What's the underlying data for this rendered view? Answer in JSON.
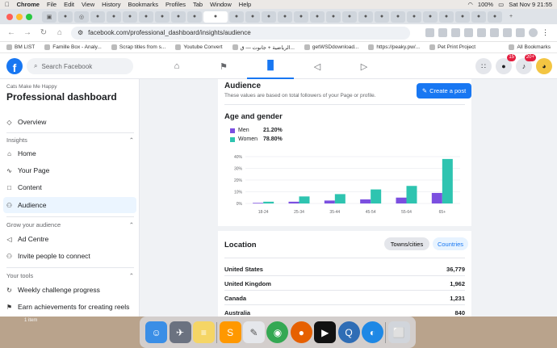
{
  "menubar": {
    "apple": "",
    "app": "Chrome",
    "items": [
      "File",
      "Edit",
      "View",
      "History",
      "Bookmarks",
      "Profiles",
      "Tab",
      "Window",
      "Help"
    ],
    "battery": "100%",
    "datetime": "Sat Nov 9  21:55"
  },
  "browser": {
    "url": "facebook.com/professional_dashboard/insights/audience",
    "bookmarks": [
      "BM LIST",
      "Famille Box - Analy...",
      "Scrap titles from s...",
      "Youtube Convert",
      "الرياضية + جانوت — ق...",
      "getWSDdownload...",
      "https://peaky.pw/...",
      "Pet Print Project"
    ],
    "all_bookmarks": "All Bookmarks"
  },
  "fb": {
    "logo": "f",
    "search_placeholder": "Search Facebook",
    "messenger_badge": "15",
    "notif_badge": "20+"
  },
  "sidebar": {
    "page_name": "Cats Make Me Happy",
    "title": "Professional dashboard",
    "overview": "Overview",
    "insights_header": "Insights",
    "home": "Home",
    "your_page": "Your Page",
    "content": "Content",
    "audience": "Audience",
    "grow_header": "Grow your audience",
    "ad_centre": "Ad Centre",
    "invite": "Invite people to connect",
    "tools_header": "Your tools",
    "weekly": "Weekly challenge progress",
    "earn": "Earn achievements for creating reels"
  },
  "audience": {
    "title": "Audience",
    "subtitle": "These values are based on total followers of your Page or profile.",
    "create_post": "Create a post",
    "age_gender_title": "Age and gender",
    "men_label": "Men",
    "men_pct": "21.20%",
    "women_label": "Women",
    "women_pct": "78.80%",
    "men_color": "#7b4fe0",
    "women_color": "#2ec4b0"
  },
  "chart_data": {
    "type": "bar",
    "categories": [
      "18-24",
      "25-34",
      "35-44",
      "45-54",
      "55-64",
      "65+"
    ],
    "series": [
      {
        "name": "Men",
        "values": [
          0.5,
          1.5,
          2.5,
          3.5,
          5,
          9
        ]
      },
      {
        "name": "Women",
        "values": [
          1.5,
          6,
          8,
          12,
          15,
          38
        ]
      }
    ],
    "yticks": [
      "0%",
      "10%",
      "20%",
      "30%",
      "40%"
    ],
    "ylim": [
      0,
      40
    ]
  },
  "location": {
    "title": "Location",
    "towns_tab": "Towns/cities",
    "countries_tab": "Countries",
    "rows": [
      {
        "name": "United States",
        "value": "36,779"
      },
      {
        "name": "United Kingdom",
        "value": "1,962"
      },
      {
        "name": "Canada",
        "value": "1,231"
      },
      {
        "name": "Australia",
        "value": "840"
      }
    ]
  },
  "desktop": {
    "label": "1 item"
  }
}
